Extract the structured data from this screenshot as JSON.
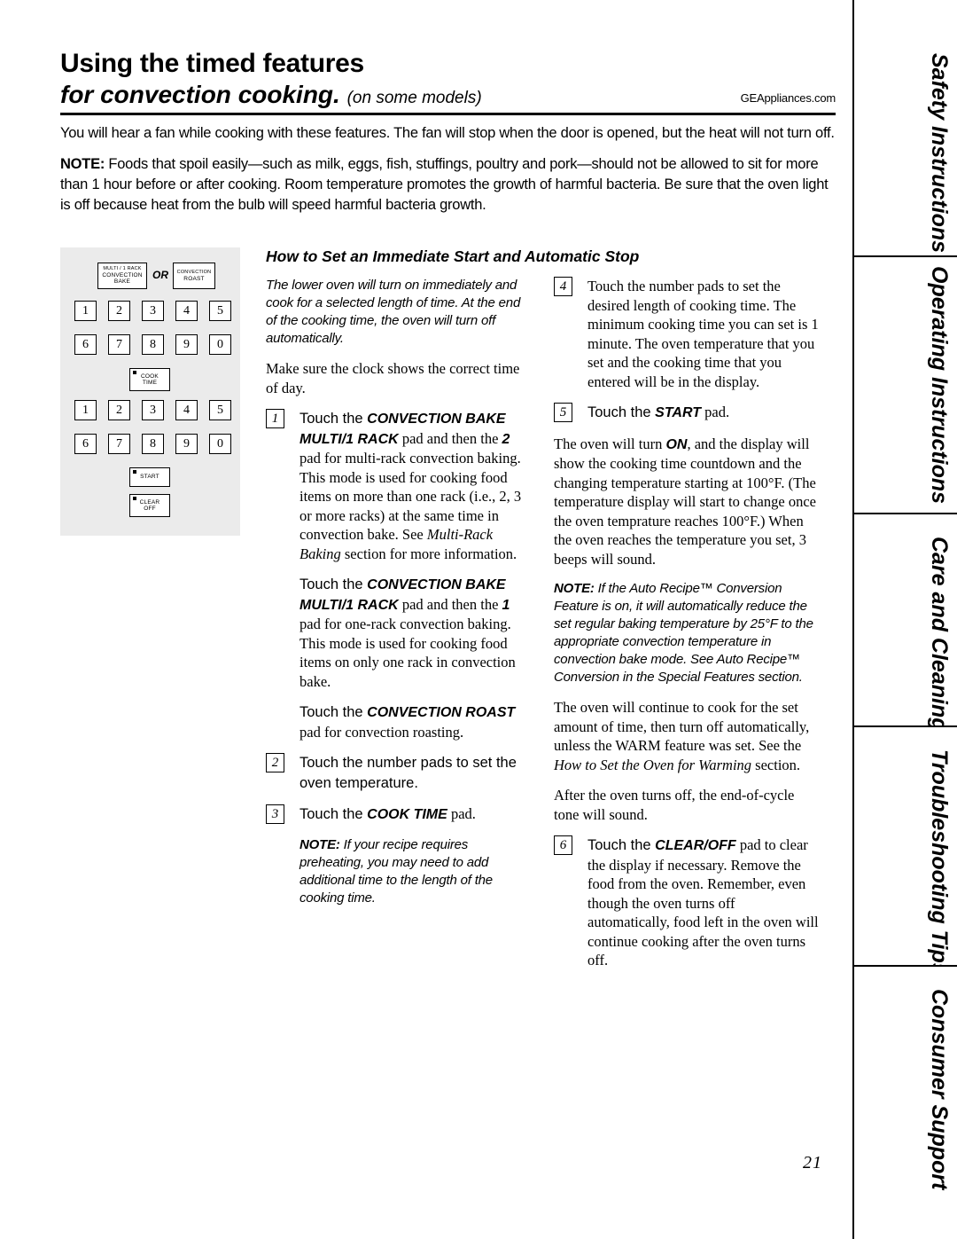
{
  "header": {
    "title_line1": "Using the timed features",
    "title_line2": "for convection cooking.",
    "title_models": "(on some models)",
    "website": "GEAppliances.com"
  },
  "intro": {
    "p1": "You will hear a fan while cooking with these features. The fan will stop when the door is opened, but the heat will not turn off.",
    "p2_label": "NOTE:",
    "p2": " Foods that spoil easily—such as milk, eggs, fish, stuffings, poultry and pork—should not be allowed to sit for more than 1 hour before or after cooking. Room temperature promotes the growth of harmful bacteria. Be sure that the oven light is off because heat from the bulb will speed harmful bacteria growth."
  },
  "keypad": {
    "pad_multirack_line1": "MULTI / 1 RACK",
    "pad_multirack_line2": "CONVECTION",
    "pad_multirack_line3": "BAKE",
    "or": "OR",
    "pad_roast_line1": "CONVECTION",
    "pad_roast_line2": "ROAST",
    "row1": [
      "1",
      "2",
      "3",
      "4",
      "5"
    ],
    "row2": [
      "6",
      "7",
      "8",
      "9",
      "0"
    ],
    "cook_time_line1": "COOK",
    "cook_time_line2": "TIME",
    "row3": [
      "1",
      "2",
      "3",
      "4",
      "5"
    ],
    "row4": [
      "6",
      "7",
      "8",
      "9",
      "0"
    ],
    "start": "START",
    "clear_line1": "CLEAR",
    "clear_line2": "OFF"
  },
  "section": {
    "heading": "How to Set an Immediate Start and Automatic Stop"
  },
  "left_column": {
    "intro_italic": "The lower oven will turn on immediately and cook for a selected length of time. At the end of the cooking time, the oven will turn off automatically.",
    "pre_step": "Make sure the clock shows the correct time of day.",
    "step1_num": "1",
    "step1_a": "Touch the ",
    "step1_b": "CONVECTION BAKE MULTI/1 RACK",
    "step1_c": " pad and then the ",
    "step1_d": "2",
    "step1_e": " pad for multi-rack convection baking. This mode is used for cooking food items on more than one rack (i.e., 2, 3 or more racks) at the same time in convection bake. See ",
    "step1_f": "Multi-Rack Baking",
    "step1_g": " section for more information.",
    "p2_a": "Touch the ",
    "p2_b": "CONVECTION BAKE MULTI/1 RACK",
    "p2_c": " pad and then the ",
    "p2_d": "1",
    "p2_e": " pad for one-rack convection baking. This mode is used for cooking food items on only one rack in convection bake.",
    "p3_a": "Touch the ",
    "p3_b": "CONVECTION ROAST",
    "p3_c": " pad for convection roasting.",
    "step2_num": "2",
    "step2_text": "Touch the number pads to set the oven temperature.",
    "step3_num": "3",
    "step3_a": "Touch the ",
    "step3_b": "COOK TIME",
    "step3_c": " pad.",
    "note_label": "NOTE:",
    "note_text": " If your recipe requires preheating, you may need to add additional time to the length of the cooking time."
  },
  "right_column": {
    "step4_num": "4",
    "step4_text": "Touch the number pads to set the desired length of cooking time. The minimum cooking time you can set is 1 minute. The oven temperature that you set and the cooking time that you entered will be in the display.",
    "step5_num": "5",
    "step5_a": "Touch the ",
    "step5_b": "START",
    "step5_c": " pad.",
    "p1_a": "The oven will turn ",
    "p1_b": "ON",
    "p1_c": ", and the display will show the cooking time countdown and the changing temperature starting at 100°F. (The temperature display will start to change once the oven temprature reaches 100°F.) When the oven reaches the temperature you set, 3 beeps will sound.",
    "note_label": "NOTE:",
    "note_text": " If the Auto Recipe™ Conversion Feature is on, it will automatically reduce the set regular baking temperature by 25°F to the appropriate convection temperature in convection bake mode. See Auto Recipe™ Conversion in the Special Features section.",
    "p2_a": "The oven will continue to cook for the set amount of time, then turn off automatically, unless the WARM feature was set. See the ",
    "p2_b": "How to Set the Oven for Warming",
    "p2_c": " section.",
    "p3": "After the oven turns off, the end-of-cycle tone will sound.",
    "step6_num": "6",
    "step6_a": "Touch the ",
    "step6_b": "CLEAR/OFF",
    "step6_c": " pad to clear the display if necessary. Remove the food from the oven. Remember, even though the oven turns off automatically, food left in the oven will continue cooking after the oven turns off."
  },
  "tabs": [
    {
      "label": "Safety Instructions"
    },
    {
      "label": "Operating Instructions"
    },
    {
      "label": "Care and Cleaning"
    },
    {
      "label": "Troubleshooting Tips"
    },
    {
      "label": "Consumer Support"
    }
  ],
  "page_number": "21"
}
